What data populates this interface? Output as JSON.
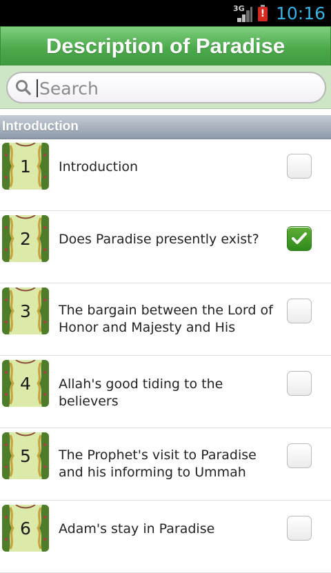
{
  "status_bar": {
    "network": "3G",
    "battery_alert": "!",
    "time": "10:16",
    "icons": [
      "signal-icon",
      "battery-alert-icon"
    ]
  },
  "app": {
    "title": "Description of Paradise",
    "accent_color": "#4caa4c"
  },
  "search": {
    "placeholder": "Search",
    "value": ""
  },
  "section": {
    "title": "Introduction"
  },
  "items": [
    {
      "number": "1",
      "title": "Introduction",
      "checked": false
    },
    {
      "number": "2",
      "title": "Does Paradise presently exist?",
      "checked": true
    },
    {
      "number": "3",
      "title": "The bargain between the Lord of Honor and Majesty and His",
      "checked": false
    },
    {
      "number": "4",
      "title": "Allah's good tiding to the believers",
      "checked": false
    },
    {
      "number": "5",
      "title": "The Prophet's visit to Paradise and his informing to Ummah",
      "checked": false
    },
    {
      "number": "6",
      "title": "Adam's stay in Paradise",
      "checked": false
    }
  ]
}
